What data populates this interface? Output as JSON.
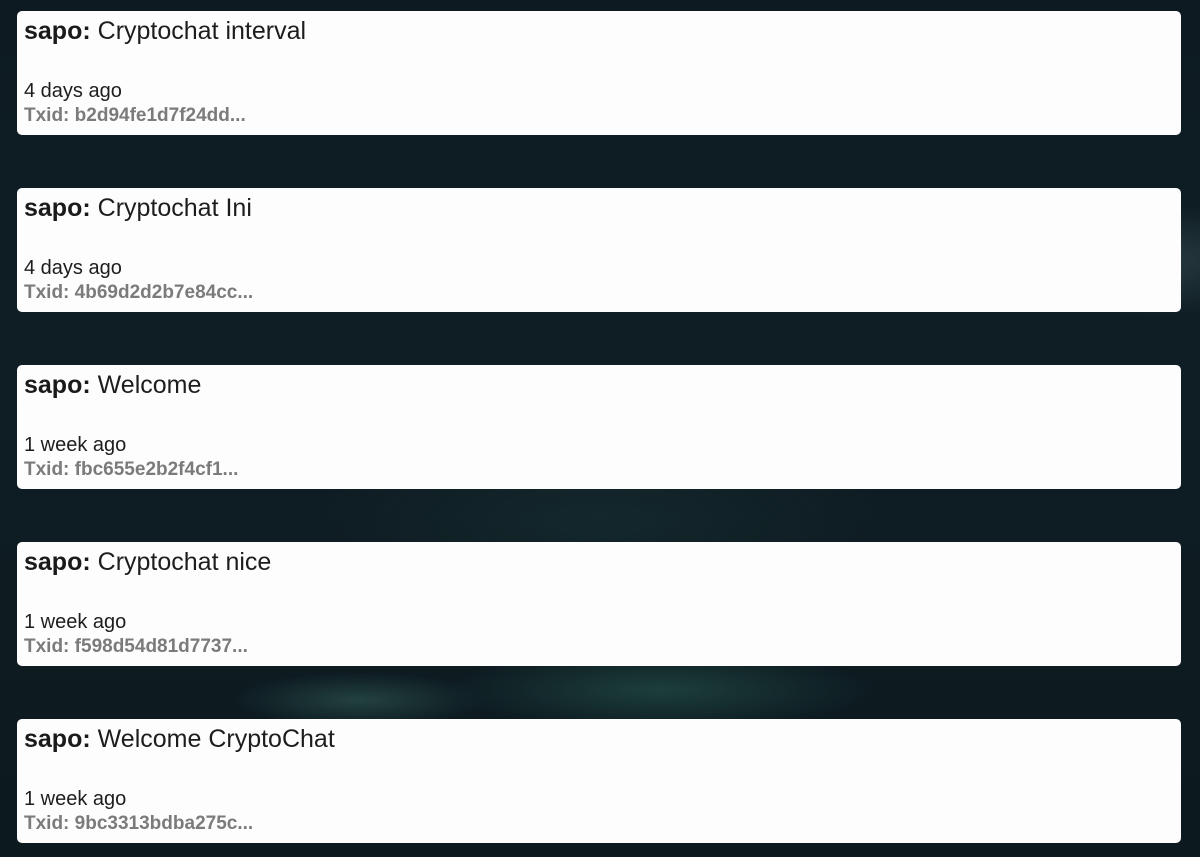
{
  "messages": [
    {
      "sender": "sapo:",
      "text": "Cryptochat interval",
      "time": "4 days ago",
      "txid_label": "Txid:",
      "txid": "b2d94fe1d7f24dd..."
    },
    {
      "sender": "sapo:",
      "text": "Cryptochat Ini",
      "time": "4 days ago",
      "txid_label": "Txid:",
      "txid": "4b69d2d2b7e84cc..."
    },
    {
      "sender": "sapo:",
      "text": "Welcome",
      "time": "1 week ago",
      "txid_label": "Txid:",
      "txid": "fbc655e2b2f4cf1..."
    },
    {
      "sender": "sapo:",
      "text": "Cryptochat nice",
      "time": "1 week ago",
      "txid_label": "Txid:",
      "txid": "f598d54d81d7737..."
    },
    {
      "sender": "sapo:",
      "text": "Welcome CryptoChat",
      "time": "1 week ago",
      "txid_label": "Txid:",
      "txid": "9bc3313bdba275c..."
    }
  ]
}
